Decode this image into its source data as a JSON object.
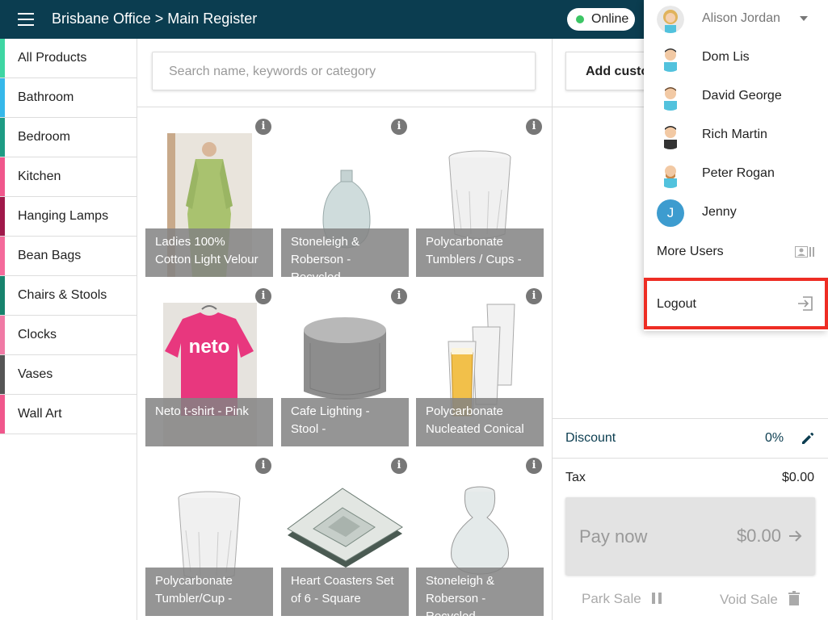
{
  "header": {
    "title": "Brisbane Office > Main Register",
    "status": "Online",
    "status_color": "#3cc565",
    "bar_color": "#0b3d50"
  },
  "sidebar": {
    "items": [
      {
        "label": "All Products",
        "color": "#3fd6a3"
      },
      {
        "label": "Bathroom",
        "color": "#36b8ea"
      },
      {
        "label": "Bedroom",
        "color": "#1e9c84"
      },
      {
        "label": "Kitchen",
        "color": "#f0578c"
      },
      {
        "label": "Hanging Lamps",
        "color": "#a0184a"
      },
      {
        "label": "Bean Bags",
        "color": "#f46a9b"
      },
      {
        "label": "Chairs & Stools",
        "color": "#17836d"
      },
      {
        "label": "Clocks",
        "color": "#f07aa5"
      },
      {
        "label": "Vases",
        "color": "#555555"
      },
      {
        "label": "Wall Art",
        "color": "#f0578c"
      }
    ]
  },
  "search": {
    "placeholder": "Search name, keywords or category"
  },
  "products": [
    {
      "name": "Ladies 100% Cotton Light Velour",
      "icon": "robe-image"
    },
    {
      "name": "Stoneleigh & Roberson - Recycled",
      "icon": "glass-bottle-image"
    },
    {
      "name": "Polycarbonate Tumblers / Cups -",
      "icon": "tumbler-image"
    },
    {
      "name": "Neto t-shirt - Pink",
      "icon": "tshirt-image"
    },
    {
      "name": "Cafe Lighting - Stool -",
      "icon": "stool-image"
    },
    {
      "name": "Polycarbonate Nucleated Conical",
      "icon": "glasses-image"
    },
    {
      "name": "Polycarbonate Tumbler/Cup -",
      "icon": "tumbler-image"
    },
    {
      "name": "Heart Coasters Set of 6 - Square",
      "icon": "coasters-image"
    },
    {
      "name": "Stoneleigh & Roberson - Recycled",
      "icon": "vase-image"
    }
  ],
  "product_info_label": "i",
  "cart": {
    "add_customer": "Add customer",
    "discount_label": "Discount",
    "discount_value": "0%",
    "tax_label": "Tax",
    "tax_value": "$0.00",
    "pay_label": "Pay now",
    "pay_amount": "$0.00",
    "park_label": "Park Sale",
    "void_label": "Void Sale"
  },
  "user_menu": {
    "current_user": "Alison Jordan",
    "users": [
      {
        "name": "Dom Lis"
      },
      {
        "name": "David George"
      },
      {
        "name": "Rich Martin"
      },
      {
        "name": "Peter Rogan"
      },
      {
        "name": "Jenny",
        "initial": "J"
      }
    ],
    "more_users": "More Users",
    "logout": "Logout",
    "highlight_color": "#ee2d24"
  }
}
